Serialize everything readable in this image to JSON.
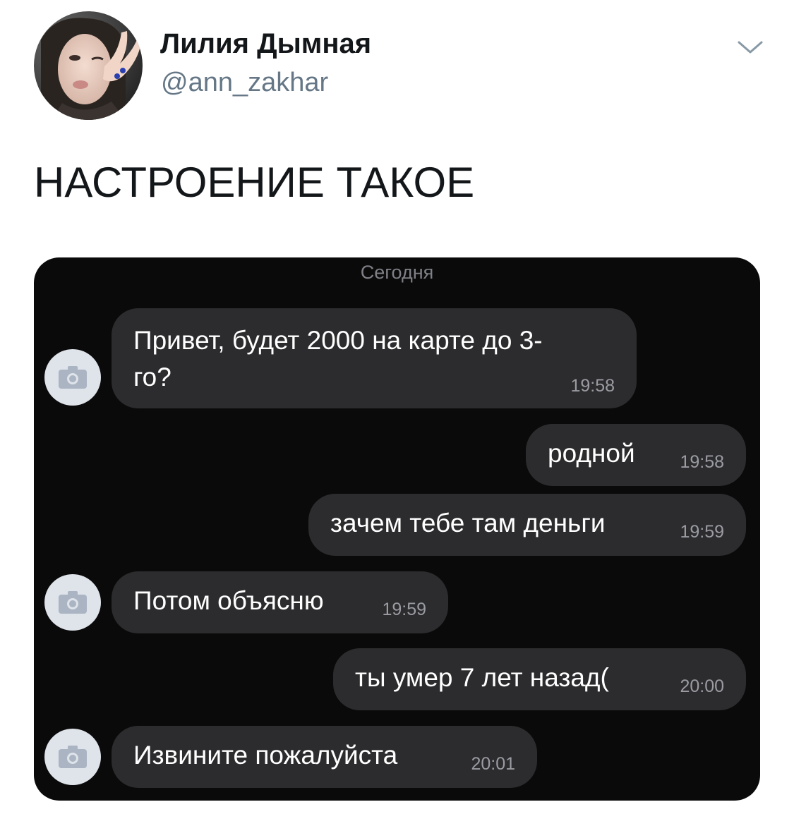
{
  "tweet": {
    "display_name": "Лилия Дымная",
    "handle": "@ann_zakhar",
    "text": "НАСТРОЕНИЕ ТАКОЕ"
  },
  "icons": {
    "avatar": "profile-photo",
    "menu": "chevron-down-icon",
    "contact_avatar": "camera-icon"
  },
  "chat": {
    "date_label": "Сегодня",
    "messages": [
      {
        "direction": "incoming",
        "line1": "Привет, будет 2000 на карте до 3-",
        "line2": "го?",
        "time": "19:58"
      },
      {
        "direction": "outgoing",
        "text": "родной",
        "time": "19:58"
      },
      {
        "direction": "outgoing",
        "text": "зачем тебе там деньги",
        "time": "19:59"
      },
      {
        "direction": "incoming",
        "text": "Потом объясню",
        "time": "19:59"
      },
      {
        "direction": "outgoing",
        "text": "ты умер 7 лет назад(",
        "time": "20:00"
      },
      {
        "direction": "incoming",
        "text": "Извините пожалуйста",
        "time": "20:01"
      }
    ]
  },
  "colors": {
    "chat_background": "#0a0a0a",
    "bubble": "#2c2c2e",
    "handle_gray": "#657786",
    "contact_avatar_bg": "#dfe3ea"
  }
}
